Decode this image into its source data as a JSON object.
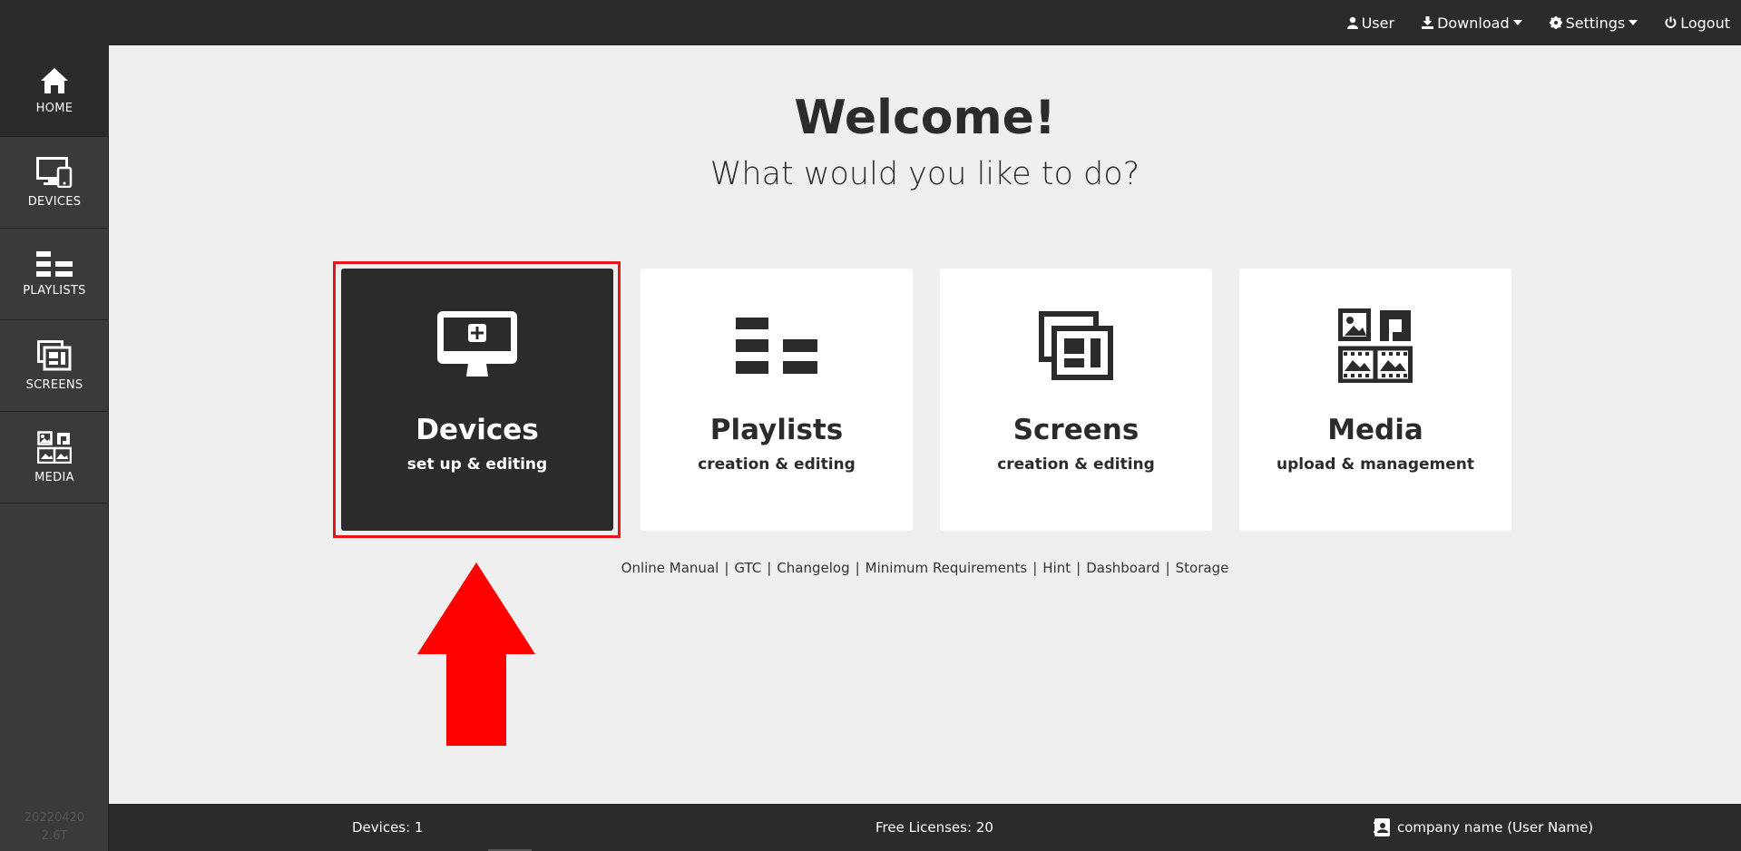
{
  "topnav": {
    "user": "User",
    "download": "Download",
    "settings": "Settings",
    "logout": "Logout"
  },
  "sidebar": {
    "items": [
      {
        "label": "HOME",
        "icon": "home-icon"
      },
      {
        "label": "DEVICES",
        "icon": "devices-icon"
      },
      {
        "label": "PLAYLISTS",
        "icon": "playlists-icon"
      },
      {
        "label": "SCREENS",
        "icon": "screens-icon"
      },
      {
        "label": "MEDIA",
        "icon": "media-icon"
      }
    ],
    "version_line1": "20220420",
    "version_line2": "2.6T"
  },
  "main": {
    "title": "Welcome!",
    "subtitle": "What would you like to do?",
    "tiles": [
      {
        "title": "Devices",
        "subtitle": "set up & editing",
        "icon": "monitor-add-icon"
      },
      {
        "title": "Playlists",
        "subtitle": "creation & editing",
        "icon": "playlists-icon"
      },
      {
        "title": "Screens",
        "subtitle": "creation & editing",
        "icon": "screens-icon"
      },
      {
        "title": "Media",
        "subtitle": "upload & management",
        "icon": "media-icon"
      }
    ],
    "links": [
      "Online Manual",
      "GTC",
      "Changelog",
      "Minimum Requirements",
      "Hint",
      "Dashboard",
      "Storage"
    ]
  },
  "footer": {
    "devices": "Devices: 1",
    "licenses": "Free Licenses: 20",
    "account": "company name (User Name)"
  },
  "colors": {
    "dark": "#2b2b2b",
    "sidebar": "#3a3a3a",
    "background": "#efefef",
    "highlight": "#e8141a",
    "arrow": "#ff0000"
  }
}
